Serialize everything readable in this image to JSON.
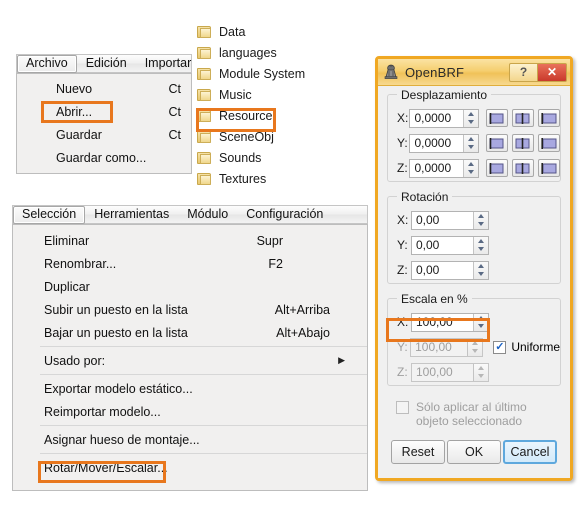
{
  "file_menubar": {
    "items": [
      {
        "label": "Archivo",
        "active": true
      },
      {
        "label": "Edición",
        "active": false
      },
      {
        "label": "Importar",
        "active": false
      }
    ]
  },
  "file_menu": {
    "items": [
      {
        "label": "Nuevo",
        "shortcut": "Ct",
        "highlight": false
      },
      {
        "label": "Abrir...",
        "shortcut": "Ct",
        "highlight": true
      },
      {
        "label": "Guardar",
        "shortcut": "Ct",
        "highlight": false
      },
      {
        "label": "Guardar como...",
        "shortcut": "",
        "highlight": false
      }
    ]
  },
  "folder_list": {
    "icon": "folder-icon",
    "items": [
      {
        "label": "Data",
        "highlight": false
      },
      {
        "label": "languages",
        "highlight": false
      },
      {
        "label": "Module System",
        "highlight": false
      },
      {
        "label": "Music",
        "highlight": false
      },
      {
        "label": "Resource",
        "highlight": true
      },
      {
        "label": "SceneObj",
        "highlight": false
      },
      {
        "label": "Sounds",
        "highlight": false
      },
      {
        "label": "Textures",
        "highlight": false
      }
    ]
  },
  "selection_menubar": {
    "items": [
      {
        "label": "Selección",
        "active": true
      },
      {
        "label": "Herramientas",
        "active": false
      },
      {
        "label": "Módulo",
        "active": false
      },
      {
        "label": "Configuración",
        "active": false
      }
    ]
  },
  "selection_menu": {
    "items": [
      {
        "type": "item",
        "label": "Eliminar",
        "shortcut": "Supr",
        "submenu": false,
        "highlight": false
      },
      {
        "type": "item",
        "label": "Renombrar...",
        "shortcut": "F2",
        "submenu": false,
        "highlight": false
      },
      {
        "type": "item",
        "label": "Duplicar",
        "shortcut": "",
        "submenu": false,
        "highlight": false
      },
      {
        "type": "item",
        "label": "Subir un puesto en la lista",
        "shortcut": "Alt+Arriba",
        "submenu": false,
        "highlight": false
      },
      {
        "type": "item",
        "label": "Bajar un puesto en la lista",
        "shortcut": "Alt+Abajo",
        "submenu": false,
        "highlight": false
      },
      {
        "type": "sep"
      },
      {
        "type": "item",
        "label": "Usado por:",
        "shortcut": "",
        "submenu": true,
        "highlight": false
      },
      {
        "type": "sep"
      },
      {
        "type": "item",
        "label": "Exportar modelo estático...",
        "shortcut": "",
        "submenu": false,
        "highlight": false
      },
      {
        "type": "item",
        "label": "Reimportar modelo...",
        "shortcut": "",
        "submenu": false,
        "highlight": false
      },
      {
        "type": "sep"
      },
      {
        "type": "item",
        "label": "Asignar hueso de montaje...",
        "shortcut": "",
        "submenu": false,
        "highlight": false
      },
      {
        "type": "sep"
      },
      {
        "type": "item",
        "label": "Rotar/Mover/Escalar...",
        "shortcut": "",
        "submenu": false,
        "highlight": true
      }
    ]
  },
  "dialog": {
    "title": "OpenBRF",
    "icon": "openbrf-app-icon",
    "help_button": "?",
    "close_button": "✕",
    "translate": {
      "title": "Desplazamiento",
      "rows": [
        {
          "axis": "X:",
          "value": "0,0000",
          "disabled": false
        },
        {
          "axis": "Y:",
          "value": "0,0000",
          "disabled": false
        },
        {
          "axis": "Z:",
          "value": "0,0000",
          "disabled": false
        }
      ],
      "align_buttons": [
        "align-min-icon",
        "align-center-icon",
        "align-max-icon"
      ]
    },
    "rotation": {
      "title": "Rotación",
      "rows": [
        {
          "axis": "X:",
          "value": "0,00",
          "disabled": false
        },
        {
          "axis": "Y:",
          "value": "0,00",
          "disabled": false
        },
        {
          "axis": "Z:",
          "value": "0,00",
          "disabled": false
        }
      ]
    },
    "scale": {
      "title": "Escala en %",
      "rows": [
        {
          "axis": "X:",
          "value": "100,00",
          "disabled": false,
          "highlight": true
        },
        {
          "axis": "Y:",
          "value": "100,00",
          "disabled": true,
          "highlight": false
        },
        {
          "axis": "Z:",
          "value": "100,00",
          "disabled": true,
          "highlight": false
        }
      ],
      "uniform_label": "Uniforme",
      "uniform_checked": true
    },
    "last_only": {
      "label_line1": "Sólo aplicar al último",
      "label_line2": "objeto seleccionado",
      "checked": false,
      "disabled": true
    },
    "buttons": [
      {
        "label": "Reset",
        "focused": false
      },
      {
        "label": "OK",
        "focused": false
      },
      {
        "label": "Cancel",
        "focused": true
      }
    ]
  },
  "colors": {
    "highlight_orange": "#e8771d",
    "dialog_border": "#f0a823",
    "titlebar_gold": "#f5cf70",
    "close_red": "#c9392b",
    "focus_blue": "#5ea8dd"
  }
}
